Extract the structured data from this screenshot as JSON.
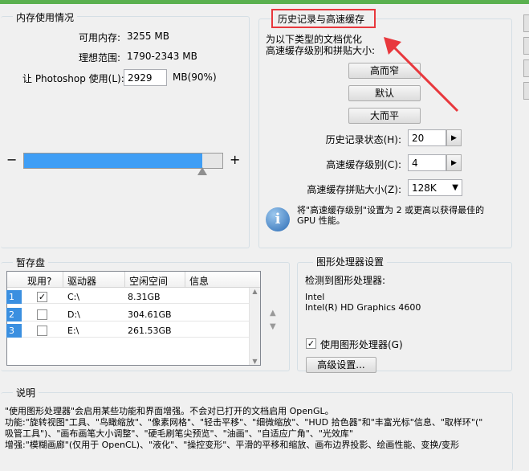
{
  "memory": {
    "title": "内存使用情况",
    "available_label": "可用内存:",
    "available_value": "3255 MB",
    "ideal_label": "理想范围:",
    "ideal_value": "1790-2343 MB",
    "let_label": "让 Photoshop 使用(L):",
    "let_value": "2929",
    "let_unit": "MB(90%)",
    "slider_minus": "−",
    "slider_plus": "+",
    "slider_fraction": 0.9
  },
  "history": {
    "title": "历史记录与高速缓存",
    "desc_line1": "为以下类型的文档优化",
    "desc_line2": "高速缓存级别和拼贴大小:",
    "btn_tall_thin": "高而窄",
    "btn_default": "默认",
    "btn_big_flat": "大而平",
    "states_label": "历史记录状态(H):",
    "states_value": "20",
    "cache_levels_label": "高速缓存级别(C):",
    "cache_levels_value": "4",
    "tile_size_label": "高速缓存拼贴大小(Z):",
    "tile_size_value": "128K",
    "info_line1": "将\"高速缓存级别\"设置为 2 或更高以获得最佳的",
    "info_line2": "GPU 性能。"
  },
  "scratch": {
    "title": "暂存盘",
    "headers": [
      "现用?",
      "驱动器",
      "空闲空间",
      "信息"
    ],
    "rows": [
      {
        "num": "1",
        "active": true,
        "drive": "C:\\",
        "free": "8.31GB",
        "info": ""
      },
      {
        "num": "2",
        "active": false,
        "drive": "D:\\",
        "free": "304.61GB",
        "info": ""
      },
      {
        "num": "3",
        "active": false,
        "drive": "E:\\",
        "free": "261.53GB",
        "info": ""
      }
    ]
  },
  "gpu": {
    "title": "图形处理器设置",
    "detected_label": "检测到图形处理器:",
    "vendor": "Intel",
    "model": "Intel(R) HD Graphics 4600",
    "use_label": "使用图形处理器(G)",
    "use_checked": true,
    "advanced_button": "高级设置..."
  },
  "description": {
    "title": "说明",
    "line1": "\"使用图形处理器\"会启用某些功能和界面增强。不会对已打开的文档启用 OpenGL。",
    "line2": "功能:\"旋转视图\"工具、\"鸟瞰缩放\"、\"像素网格\"、\"轻击平移\"、\"细微缩放\"、\"HUD 拾色器\"和\"丰富光标\"信息、\"取样环\"(\"",
    "line3": "吸管工具\")、\"画布画笔大小调整\"、\"硬毛刷笔尖预览\"、\"油画\"、\"自适应广角\"、\"光效库\"",
    "line4": "增强:\"模糊画廊\"(仅用于 OpenCL)、\"液化\"、\"操控变形\"、平滑的平移和缩放、画布边界投影、绘画性能、变换/变形"
  },
  "colors": {
    "annotation_red": "#e8383d",
    "slider_blue": "#3f9ef5",
    "row_blue": "#3a8fe0"
  }
}
